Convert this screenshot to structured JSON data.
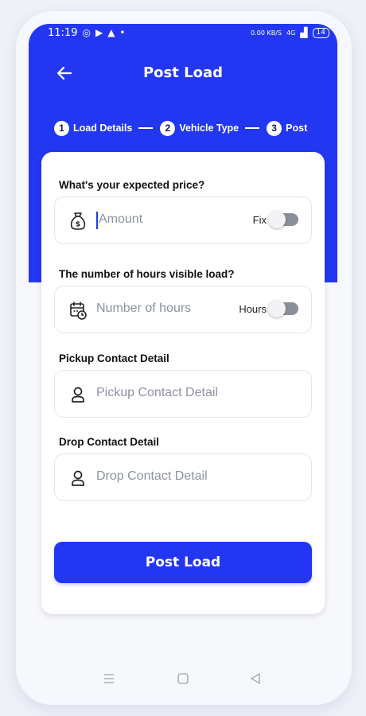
{
  "status_bar": {
    "time": "11:19",
    "net_speed": "0.00 KB/S",
    "network": "4G",
    "battery": "14"
  },
  "header": {
    "title": "Post Load"
  },
  "stepper": {
    "steps": [
      {
        "number": "1",
        "label": "Load Details"
      },
      {
        "number": "2",
        "label": "Vehicle Type"
      },
      {
        "number": "3",
        "label": "Post"
      }
    ]
  },
  "form": {
    "price": {
      "label": "What's your expected price?",
      "placeholder": "Amount",
      "toggle_label": "Fix",
      "toggle_on": false
    },
    "hours": {
      "label": "The number of hours visible load?",
      "placeholder": "Number of hours",
      "toggle_label": "Hours",
      "toggle_on": false
    },
    "pickup": {
      "label": "Pickup Contact Detail",
      "placeholder": "Pickup Contact Detail"
    },
    "drop": {
      "label": "Drop Contact Detail",
      "placeholder": "Drop Contact Detail"
    },
    "submit_label": "Post Load"
  },
  "colors": {
    "primary": "#2337f2",
    "background": "#f7f8fc",
    "toggle_off": "#8a8f99"
  },
  "icons": {
    "back": "arrow-left-icon",
    "price": "money-bag-icon",
    "hours": "calendar-clock-icon",
    "pickup": "user-icon",
    "drop": "user-icon",
    "nav": [
      "menu-icon",
      "home-square-icon",
      "back-triangle-icon"
    ]
  }
}
